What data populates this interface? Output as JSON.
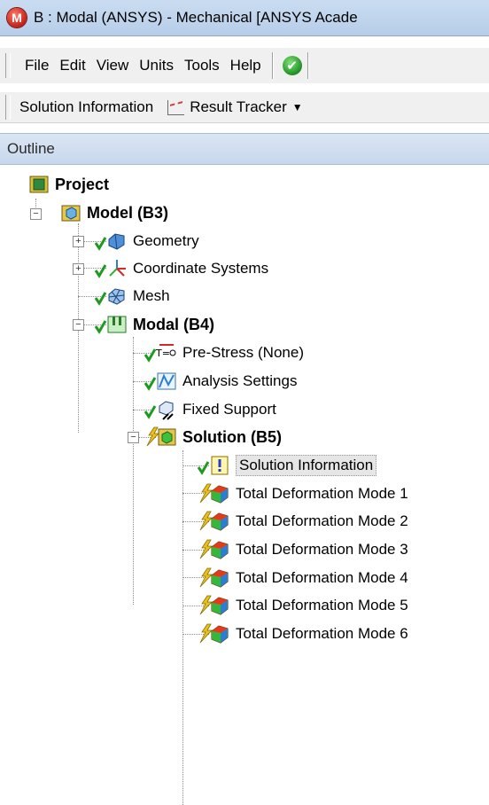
{
  "window": {
    "title": "B : Modal (ANSYS) - Mechanical [ANSYS Acade"
  },
  "menu": {
    "items": [
      "File",
      "Edit",
      "View",
      "Units",
      "Tools",
      "Help"
    ]
  },
  "toolbar": {
    "solution_information": "Solution Information",
    "result_tracker": "Result Tracker"
  },
  "outline": {
    "header": "Outline"
  },
  "tree": {
    "project": "Project",
    "model": "Model (B3)",
    "geometry": "Geometry",
    "coordinate_systems": "Coordinate Systems",
    "mesh": "Mesh",
    "modal": "Modal (B4)",
    "pre_stress": "Pre-Stress (None)",
    "analysis_settings": "Analysis Settings",
    "fixed_support": "Fixed Support",
    "solution": "Solution (B5)",
    "solution_information": "Solution Information",
    "modes": [
      "Total Deformation Mode 1",
      "Total Deformation Mode 2",
      "Total Deformation Mode 3",
      "Total Deformation Mode 4",
      "Total Deformation Mode 5",
      "Total Deformation Mode 6"
    ]
  },
  "colors": {
    "check": "#1f9a1f",
    "bolt": "#e8c21a",
    "title_bar": "#c9dcf1",
    "outline_header": "#d3e0f0"
  }
}
